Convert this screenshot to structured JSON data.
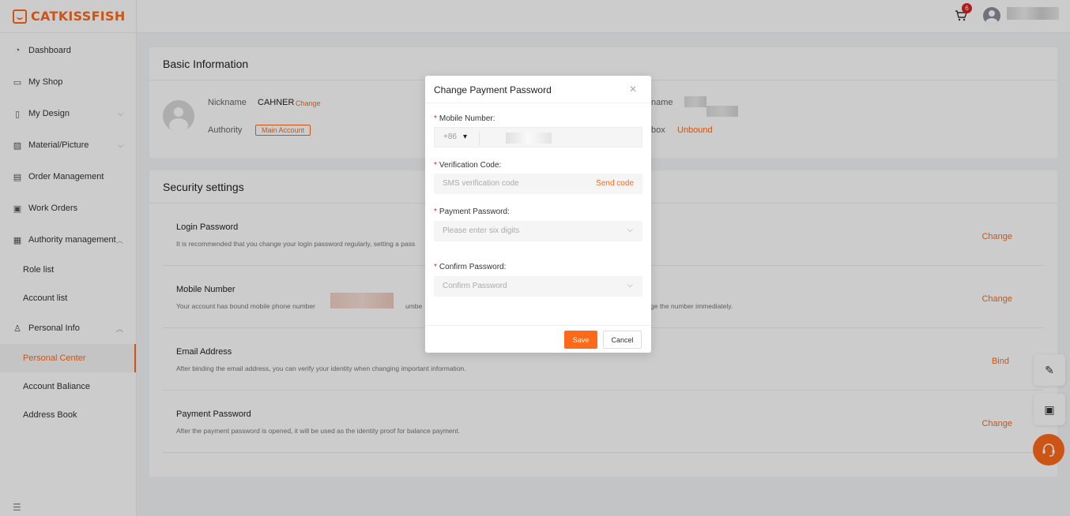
{
  "brand": {
    "name": "CATKISSFISH",
    "color": "#ff6a1a"
  },
  "sidebar": {
    "items": [
      {
        "label": "Dashboard",
        "icon": "dashboard-icon"
      },
      {
        "label": "My Shop",
        "icon": "shop-icon"
      },
      {
        "label": "My Design",
        "icon": "design-icon",
        "expandable": true
      },
      {
        "label": "Material/Picture",
        "icon": "picture-icon",
        "expandable": true
      },
      {
        "label": "Order Management",
        "icon": "order-icon"
      },
      {
        "label": "Work Orders",
        "icon": "work-order-icon"
      },
      {
        "label": "Authority management",
        "icon": "authority-icon",
        "expanded": true
      }
    ],
    "authority_sub": [
      "Role list",
      "Account list"
    ],
    "personal_info": {
      "label": "Personal Info",
      "icon": "user-icon"
    },
    "personal_sub": [
      "Personal Center",
      "Account Baliance",
      "Address Book"
    ],
    "active": "Personal Center"
  },
  "topbar": {
    "cart_count": "6"
  },
  "basic_info": {
    "title": "Basic Information",
    "nickname_label": "Nickname",
    "nickname": "CAHNER",
    "change": "Change",
    "authority_label": "Authority",
    "authority_tag": "Main Account",
    "name_label_partial": "name",
    "box_label_partial": "box",
    "unbound": "Unbound"
  },
  "security": {
    "title": "Security settings",
    "rows": [
      {
        "title": "Login Password",
        "desc": "It is recommended that you change your login password regularly, setting a pass",
        "action": "Change"
      },
      {
        "title": "Mobile Number",
        "desc": "Your account has bound mobile phone number",
        "desc_mid": "umbe",
        "desc_tail": "ge the number immediately.",
        "action": "Change"
      },
      {
        "title": "Email Address",
        "desc": "After binding the email address, you can verify your identity when changing important information.",
        "action": "Bind"
      },
      {
        "title": "Payment Password",
        "desc": "After the payment password is opened, it will be used as the identity proof for balance payment.",
        "action": "Change"
      }
    ]
  },
  "modal": {
    "title": "Change Payment Password",
    "mobile_label": "Mobile Number:",
    "country_code": "+86",
    "verification_label": "Verification Code:",
    "verification_placeholder": "SMS verification code",
    "send_code": "Send code",
    "payment_label": "Payment Password:",
    "payment_placeholder": "Please enter six digits",
    "confirm_label": "Confirm Password:",
    "confirm_placeholder": "Confirm Password",
    "save": "Save",
    "cancel": "Cancel"
  }
}
